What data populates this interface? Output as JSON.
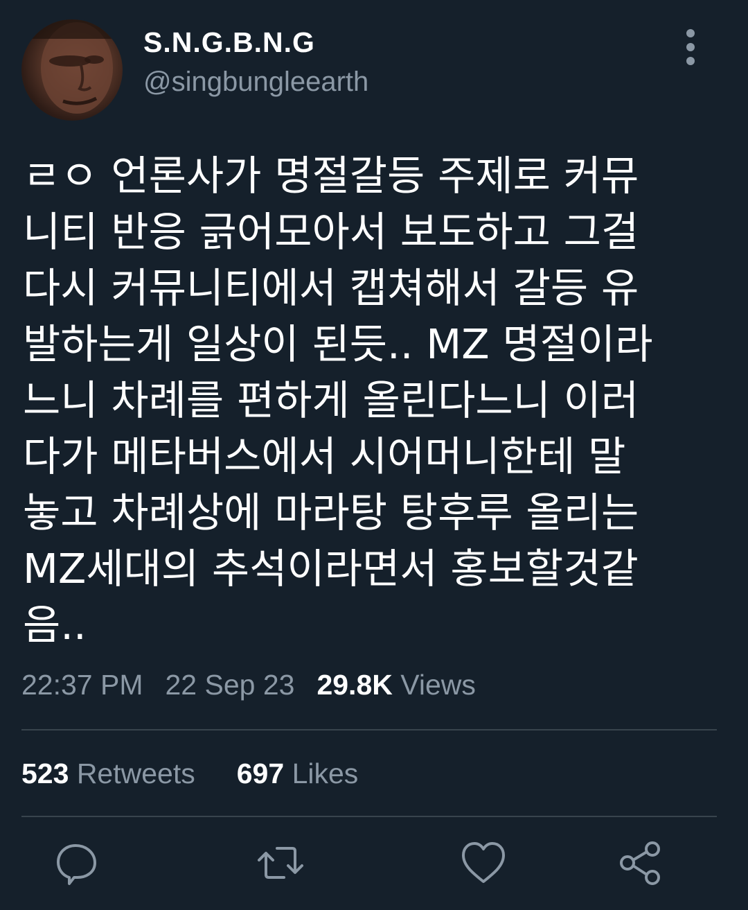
{
  "user": {
    "display_name": "S.N.G.B.N.G",
    "handle": "@singbungleearth"
  },
  "tweet": {
    "lines": [
      "ㄹㅇ 언론사가 명절갈등 주제로 커뮤",
      "니티 반응 긁어모아서 보도하고 그걸",
      "다시 커뮤니티에서 캡쳐해서 갈등 유",
      "발하는게 일상이 된듯.. MZ 명절이라",
      "느니 차례를 편하게 올린다느니 이러",
      "다가 메타버스에서 시어머니한테 말",
      "놓고 차례상에 마라탕 탕후루 올리는",
      "MZ세대의 추석이라면서 홍보할것같",
      "음.."
    ],
    "time": "22:37 PM",
    "date": "22 Sep 23",
    "views_count": "29.8K",
    "views_label": "Views"
  },
  "stats": {
    "retweets_count": "523",
    "retweets_label": "Retweets",
    "likes_count": "697",
    "likes_label": "Likes"
  },
  "icons": {
    "more": "more-vertical-icon",
    "reply": "reply-icon",
    "retweet": "retweet-icon",
    "like": "heart-icon",
    "share": "share-icon"
  },
  "colors": {
    "background": "#15202b",
    "primary_text": "#ffffff",
    "secondary_text": "#8b98a5",
    "divider": "#38444d"
  }
}
